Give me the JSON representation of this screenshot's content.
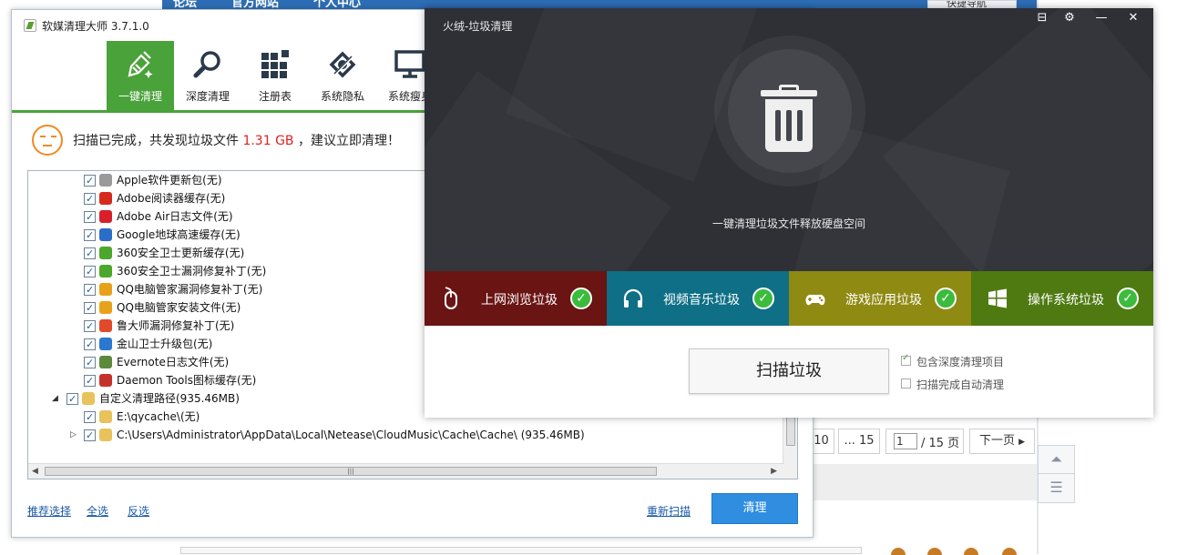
{
  "background_page": {
    "topbar_items": [
      "论坛",
      "官方网站",
      "个人中心"
    ],
    "dropdown_label": "快捷导航",
    "pager": {
      "prev_page": "10",
      "ellipsis_page": "... 15",
      "current_page": "1",
      "total_pages": "/ 15 页",
      "next": "下一页"
    }
  },
  "cleaner": {
    "title": "软媒清理大师 3.7.1.0",
    "toolbar": [
      {
        "label": "一键清理",
        "icon": "broom-icon",
        "active": true
      },
      {
        "label": "深度清理",
        "icon": "magnifier-icon"
      },
      {
        "label": "注册表",
        "icon": "registry-grid-icon"
      },
      {
        "label": "系统隐私",
        "icon": "privacy-shield-icon"
      },
      {
        "label": "系统瘦身",
        "icon": "monitor-icon"
      }
    ],
    "status": {
      "prefix": "扫描已完成，共发现垃圾文件 ",
      "size": "1.31 GB",
      "suffix": " ，建议立即清理！"
    },
    "tree_items": [
      {
        "label": "Apple软件更新包(无)",
        "icon": "apple-icon",
        "color": "#9a9a9a"
      },
      {
        "label": "Adobe阅读器缓存(无)",
        "icon": "adobe-reader-icon",
        "color": "#d62a1d"
      },
      {
        "label": "Adobe Air日志文件(无)",
        "icon": "adobe-air-icon",
        "color": "#d9202a"
      },
      {
        "label": "Google地球高速缓存(无)",
        "icon": "google-earth-icon",
        "color": "#2a6ec9"
      },
      {
        "label": "360安全卫士更新缓存(无)",
        "icon": "360-icon",
        "color": "#4ca82c"
      },
      {
        "label": "360安全卫士漏洞修复补丁(无)",
        "icon": "360-icon",
        "color": "#4ca82c"
      },
      {
        "label": "QQ电脑管家漏洞修复补丁(无)",
        "icon": "qq-guard-icon",
        "color": "#e8a21a"
      },
      {
        "label": "QQ电脑管家安装文件(无)",
        "icon": "qq-guard-icon",
        "color": "#e8a21a"
      },
      {
        "label": "鲁大师漏洞修复补丁(无)",
        "icon": "ludashi-icon",
        "color": "#e04a2a"
      },
      {
        "label": "金山卫士升级包(无)",
        "icon": "kingsoft-shield-icon",
        "color": "#2a78d0"
      },
      {
        "label": "Evernote日志文件(无)",
        "icon": "evernote-icon",
        "color": "#5c8a3c"
      },
      {
        "label": "Daemon Tools图标缓存(无)",
        "icon": "daemon-tools-icon",
        "color": "#c6302a"
      }
    ],
    "custom_path": {
      "label": "自定义清理路径(935.46MB)",
      "icon": "folder-icon"
    },
    "custom_children": [
      {
        "label": "E:\\qycache\\(无)",
        "icon": "folder-icon"
      },
      {
        "label": "C:\\Users\\Administrator\\AppData\\Local\\Netease\\CloudMusic\\Cache\\Cache\\  (935.46MB)",
        "icon": "folder-icon"
      }
    ],
    "links": {
      "recommend": "推荐选择",
      "select_all": "全选",
      "invert": "反选",
      "rescan": "重新扫描"
    },
    "clean_button": "清理"
  },
  "popup": {
    "title": "火绒-垃圾清理",
    "subtitle": "一键清理垃圾文件释放硬盘空间",
    "categories": [
      {
        "label": "上网浏览垃圾",
        "icon": "mouse-icon",
        "color": "#6a1414"
      },
      {
        "label": "视频音乐垃圾",
        "icon": "headphones-icon",
        "color": "#0e6f86"
      },
      {
        "label": "游戏应用垃圾",
        "icon": "gamepad-icon",
        "color": "#8f8a12"
      },
      {
        "label": "操作系统垃圾",
        "icon": "windows-icon",
        "color": "#4f7a12"
      }
    ],
    "scan_button": "扫描垃圾",
    "options": [
      {
        "label": "包含深度清理项目",
        "checked": true
      },
      {
        "label": "扫描完成自动清理",
        "checked": false
      }
    ]
  }
}
